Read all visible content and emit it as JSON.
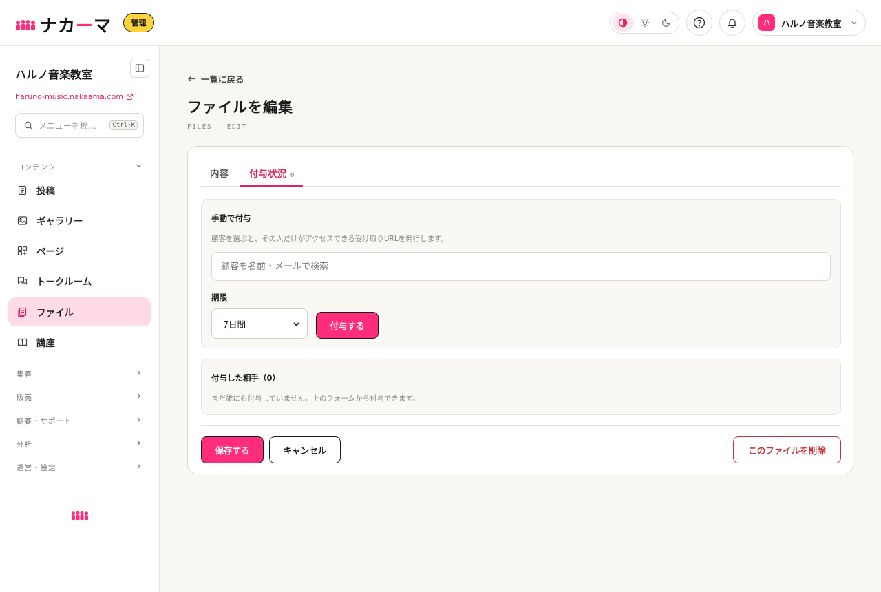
{
  "header": {
    "logo_text_a": "ナカ",
    "logo_text_dash": "ー",
    "logo_text_b": "マ",
    "admin_badge": "管理",
    "account_avatar": "ハ",
    "account_name": "ハルノ音楽教室"
  },
  "sidebar": {
    "site_name": "ハルノ音楽教室",
    "site_url": "haruno-music.nakaama.com",
    "search_placeholder": "メニューを検…",
    "search_shortcut": "Ctrl+K",
    "content_group": "コンテンツ",
    "items": [
      {
        "label": "投稿",
        "icon": "document-icon"
      },
      {
        "label": "ギャラリー",
        "icon": "image-icon"
      },
      {
        "label": "ページ",
        "icon": "pages-icon"
      },
      {
        "label": "トークルーム",
        "icon": "chat-icon"
      },
      {
        "label": "ファイル",
        "icon": "file-icon"
      },
      {
        "label": "講座",
        "icon": "book-icon"
      }
    ],
    "groups": [
      "集客",
      "販売",
      "顧客・サポート",
      "分析",
      "運営・設定"
    ]
  },
  "main": {
    "back_link": "一覧に戻る",
    "title": "ファイルを編集",
    "subtitle": "FILES — EDIT",
    "tabs": [
      {
        "label": "内容"
      },
      {
        "label": "付与状況",
        "count": "0"
      }
    ],
    "grant_panel": {
      "title": "手動で付与",
      "description": "顧客を選ぶと、その人だけがアクセスできる受け取りURLを発行します。",
      "search_placeholder": "顧客を名前・メールで検索",
      "expiry_label": "期限",
      "expiry_value": "7日間",
      "grant_button": "付与する"
    },
    "granted_panel": {
      "title": "付与した相手（0）",
      "empty_text": "まだ誰にも付与していません。上のフォームから付与できます。"
    },
    "save_button": "保存する",
    "cancel_button": "キャンセル",
    "delete_button": "このファイルを削除"
  },
  "colors": {
    "accent": "#ff2d7a",
    "accent_light": "#ffdbe8",
    "badge_yellow": "#ffd43b",
    "danger": "#c4323c"
  }
}
